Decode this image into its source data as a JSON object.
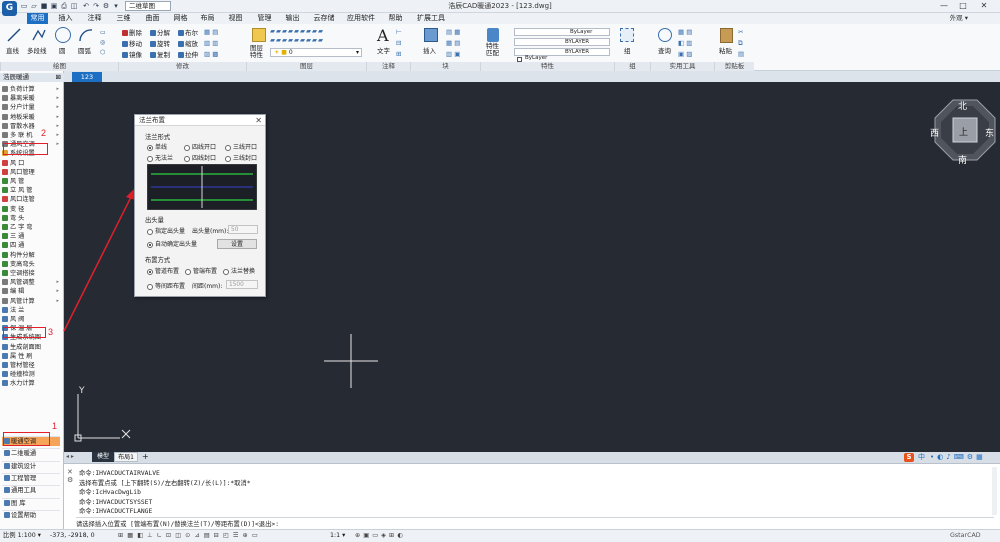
{
  "titlebar": {
    "doc_tab": "二维草图",
    "window_title": "浩辰CAD暖通2023 - [123.dwg]",
    "minimize": "—",
    "maximize": "□",
    "close": "✕"
  },
  "menubar": {
    "items": [
      "常用",
      "插入",
      "注释",
      "三维",
      "曲面",
      "网格",
      "布局",
      "视图",
      "管理",
      "输出",
      "云存储",
      "应用软件",
      "帮助",
      "扩展工具"
    ],
    "active_index": 0,
    "outer_view_label": "外观 ▾"
  },
  "ribbon": {
    "draw_tools": [
      "直线",
      "多段线",
      "圆",
      "圆弧"
    ],
    "modify_tools": [
      "删除",
      "分解",
      "布尔",
      "移动",
      "旋转",
      "缩放",
      "镜像",
      "复制",
      "拉伸"
    ],
    "layer_tool": "图层\n特性",
    "layer_value": "0",
    "annotation_tool": "文字",
    "block_tool": "插入",
    "property_match": "特性\n匹配",
    "bylayer_values": [
      "ByLayer",
      "BYLAYER",
      "BYLAYER",
      "ByLayer"
    ],
    "group_tool": "组",
    "query_tool": "查询",
    "paste_tool": "粘贴",
    "groups": [
      "绘图",
      "修改",
      "图层",
      "注释",
      "块",
      "特性",
      "组",
      "实用工具",
      "剪贴板"
    ]
  },
  "left_panel": {
    "header": "浩辰暖通",
    "items": [
      {
        "label": "负荷计算",
        "color": "#7a7a7a",
        "arrow": true
      },
      {
        "label": "暴离采暖",
        "color": "#7a7a7a",
        "arrow": true
      },
      {
        "label": "分户计量",
        "color": "#7a7a7a",
        "arrow": true
      },
      {
        "label": "地板采暖",
        "color": "#7a7a7a",
        "arrow": true
      },
      {
        "label": "冒散水器",
        "color": "#7a7a7a",
        "arrow": true
      },
      {
        "label": "多 联 机",
        "color": "#7a7a7a",
        "arrow": true
      },
      {
        "label": "通风空调",
        "color": "#7a7a7a",
        "arrow": true
      },
      {
        "label": "系统设置",
        "color": "#e0a030",
        "arrow": false
      },
      {
        "label": "风    口",
        "color": "#d04040",
        "arrow": false
      },
      {
        "label": "风口管理",
        "color": "#d04040",
        "arrow": false
      },
      {
        "label": "风    管",
        "color": "#3a8a3a",
        "arrow": false
      },
      {
        "label": "立 风 管",
        "color": "#3a8a3a",
        "arrow": false
      },
      {
        "label": "风口连管",
        "color": "#d04040",
        "arrow": false
      },
      {
        "label": "变    径",
        "color": "#3a8a3a",
        "arrow": false
      },
      {
        "label": "弯    头",
        "color": "#3a8a3a",
        "arrow": false
      },
      {
        "label": "乙 字 弯",
        "color": "#3a8a3a",
        "arrow": false
      },
      {
        "label": "三    通",
        "color": "#3a8a3a",
        "arrow": false
      },
      {
        "label": "四    通",
        "color": "#3a8a3a",
        "arrow": false
      },
      {
        "label": "构件分解",
        "color": "#3a8a3a",
        "arrow": false
      },
      {
        "label": "变高弯头",
        "color": "#3a8a3a",
        "arrow": false
      },
      {
        "label": "空调搭接",
        "color": "#3a8a3a",
        "arrow": false
      },
      {
        "label": "风管调整",
        "color": "#7a7a7a",
        "arrow": true
      },
      {
        "label": "编    辑",
        "color": "#7a7a7a",
        "arrow": true
      },
      {
        "label": "风管计算",
        "color": "#7a7a7a",
        "arrow": true
      },
      {
        "label": "法    兰",
        "color": "#4a7ab0",
        "arrow": false
      },
      {
        "label": "风    阀",
        "color": "#4a7ab0",
        "arrow": false
      },
      {
        "label": "保 温 层",
        "color": "#4a7ab0",
        "arrow": false
      },
      {
        "label": "生成系统图",
        "color": "#4a7ab0",
        "arrow": false
      },
      {
        "label": "生成剖面图",
        "color": "#4a7ab0",
        "arrow": false
      },
      {
        "label": "属 性 刷",
        "color": "#4a7ab0",
        "arrow": false
      },
      {
        "label": "管材管径",
        "color": "#4a7ab0",
        "arrow": false
      },
      {
        "label": "碰撞检测",
        "color": "#4a7ab0",
        "arrow": false
      },
      {
        "label": "水力计算",
        "color": "#4a7ab0",
        "arrow": false
      }
    ],
    "bottom_items": [
      "暖通空调",
      "二维暖通",
      "建筑设计",
      "工程管理",
      "通用工具",
      "图    库",
      "设置帮助"
    ],
    "annotations": [
      "1",
      "2",
      "3"
    ]
  },
  "drawing_tabs": {
    "active_tab": "123"
  },
  "canvas": {
    "compass": {
      "north": "北",
      "south": "南",
      "east": "东",
      "west": "西",
      "center": "上"
    },
    "ucs_x": "X",
    "ucs_y": "Y"
  },
  "layout_tabs": {
    "model": "模型",
    "layout1": "布局1",
    "add": "+"
  },
  "dialog": {
    "title": "法兰布置",
    "section_form": "法兰形式",
    "form_options": [
      "单线",
      "四线开口",
      "三线开口",
      "无法兰",
      "四线封口",
      "三线封口"
    ],
    "form_selected": 0,
    "section_protrude": "出头量",
    "protrude_options": [
      "指定出头量",
      "自动确定出头量"
    ],
    "protrude_selected": 1,
    "protrude_label": "出头量(mm):",
    "protrude_value": "50",
    "settings_button": "设置",
    "section_layout": "布置方式",
    "layout_options": [
      "管道布置",
      "管端布置",
      "法兰替换",
      "等间距布置"
    ],
    "layout_selected": 0,
    "spacing_label": "间距(mm):",
    "spacing_value": "1500"
  },
  "command_history": [
    "命令:IHVACDUCTAIRVALVE",
    "选择布置点或 [上下翻转(S)/左右翻转(Z)/长(L)]:*取消*",
    "命令:IcHvacDwgLib",
    "命令:IHVACDUCTSYSSET",
    "命令:IHVACDUCTFLANGE",
    "请选择插入位置或 [管端布置(N)/替换法兰(T)/等距布置(D)]<退出>:"
  ],
  "ime": {
    "logo": "S",
    "lang": "中"
  },
  "status_bar": {
    "scale": "比例 1:100 ▾",
    "coords": "-373, -2918, 0",
    "zoom": "1:1 ▾",
    "brand": "GstarCAD"
  }
}
